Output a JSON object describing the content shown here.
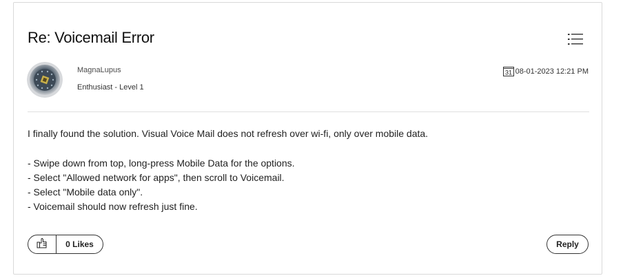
{
  "post": {
    "title": "Re: Voicemail Error",
    "author": {
      "name": "MagnaLupus",
      "rank": "Enthusiast - Level 1"
    },
    "date": {
      "calendar_day": "31",
      "text": "08-01-2023 12:21 PM"
    },
    "body": {
      "intro": "I finally found the solution. Visual Voice Mail does not refresh over wi-fi, only over mobile data.",
      "steps": [
        "- Swipe down from top, long-press Mobile Data for the options.",
        "- Select \"Allowed network for apps\", then scroll to Voicemail.",
        "- Select \"Mobile data only\".",
        "- Voicemail should now refresh just fine."
      ]
    },
    "kudos": {
      "count_label": "0 Likes"
    },
    "reply_label": "Reply"
  },
  "icons": {
    "menu": "list-menu-icon",
    "calendar": "calendar-icon",
    "like": "thumbs-up-icon",
    "avatar": "user-avatar"
  }
}
